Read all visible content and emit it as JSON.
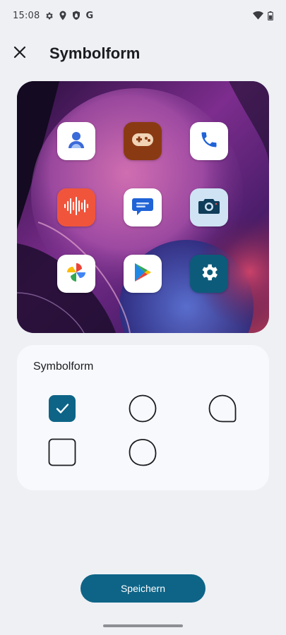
{
  "status_bar": {
    "time": "15:08",
    "left_icons": [
      "gear-icon",
      "location-icon",
      "shield-icon",
      "google-icon"
    ],
    "google_letter": "G",
    "right_icons": [
      "wifi-icon",
      "battery-icon"
    ]
  },
  "app_bar": {
    "close_icon": "close-icon",
    "title": "Symbolform"
  },
  "preview": {
    "apps": [
      {
        "name": "contacts",
        "icon": "contacts-icon"
      },
      {
        "name": "games",
        "icon": "gamepad-icon"
      },
      {
        "name": "phone",
        "icon": "phone-icon"
      },
      {
        "name": "recorder",
        "icon": "soundwave-icon"
      },
      {
        "name": "messages",
        "icon": "chat-icon"
      },
      {
        "name": "camera",
        "icon": "camera-icon"
      },
      {
        "name": "photos",
        "icon": "pinwheel-icon"
      },
      {
        "name": "play-store",
        "icon": "play-icon"
      },
      {
        "name": "settings",
        "icon": "gear-icon"
      }
    ]
  },
  "shape_card": {
    "title": "Symbolform",
    "options": [
      {
        "shape": "rounded-square",
        "selected": true
      },
      {
        "shape": "circle",
        "selected": false
      },
      {
        "shape": "teardrop",
        "selected": false
      },
      {
        "shape": "square",
        "selected": false
      },
      {
        "shape": "pebble",
        "selected": false
      }
    ]
  },
  "save_button": {
    "label": "Speichern"
  },
  "colors": {
    "accent": "#0d6487",
    "background": "#eef0f4",
    "card": "#f8f9fc"
  }
}
